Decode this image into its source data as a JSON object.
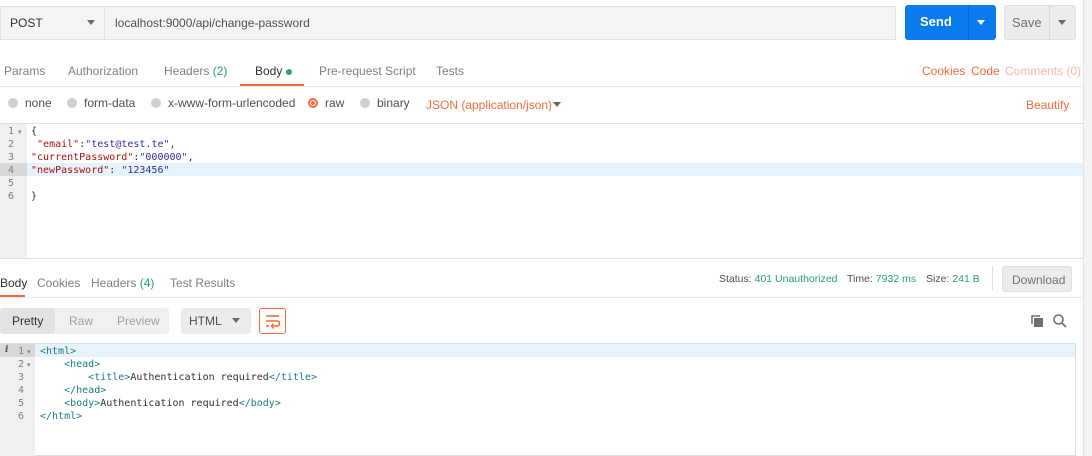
{
  "request": {
    "method": "POST",
    "url": "localhost:9000/api/change-password",
    "send_label": "Send",
    "save_label": "Save"
  },
  "request_tabs": {
    "params": "Params",
    "authorization": "Authorization",
    "headers_label": "Headers",
    "headers_count": "(2)",
    "body": "Body",
    "prerequest": "Pre-request Script",
    "tests": "Tests"
  },
  "request_links": {
    "cookies": "Cookies",
    "code": "Code",
    "comments": "Comments (0)"
  },
  "body_types": {
    "none": "none",
    "form_data": "form-data",
    "urlencoded": "x-www-form-urlencoded",
    "raw": "raw",
    "binary": "binary",
    "content_type": "JSON (application/json)",
    "beautify": "Beautify"
  },
  "request_body": {
    "line_numbers": [
      "1",
      "2",
      "3",
      "4",
      "5",
      "6"
    ],
    "open_brace": "{",
    "email_key": "\"email\"",
    "email_val": "\"test@test.te\"",
    "current_key": "\"currentPassword\"",
    "current_val": "\"000000\"",
    "new_key": "\"newPassword\"",
    "new_val": "\"123456\"",
    "close_brace": "}"
  },
  "response_tabs": {
    "body": "Body",
    "cookies": "Cookies",
    "headers_label": "Headers",
    "headers_count": "(4)",
    "test_results": "Test Results"
  },
  "response_meta": {
    "status_label": "Status:",
    "status_value": "401 Unauthorized",
    "time_label": "Time:",
    "time_value": "7932 ms",
    "size_label": "Size:",
    "size_value": "241 B",
    "download_label": "Download"
  },
  "response_view": {
    "pretty": "Pretty",
    "raw": "Raw",
    "preview": "Preview",
    "format": "HTML"
  },
  "response_body": {
    "line_numbers": [
      "1",
      "2",
      "3",
      "4",
      "5",
      "6"
    ],
    "info_marker": "i",
    "html_open": "<html>",
    "head_open": "<head>",
    "title_open": "<title>",
    "title_text": "Authentication required",
    "title_close": "</title>",
    "head_close": "</head>",
    "body_open": "<body>",
    "body_text": "Authentication required",
    "body_close": "</body>",
    "html_close": "</html>"
  },
  "colors": {
    "send": "#097bed",
    "accent": "#f26b3a",
    "success": "#26a26d"
  }
}
